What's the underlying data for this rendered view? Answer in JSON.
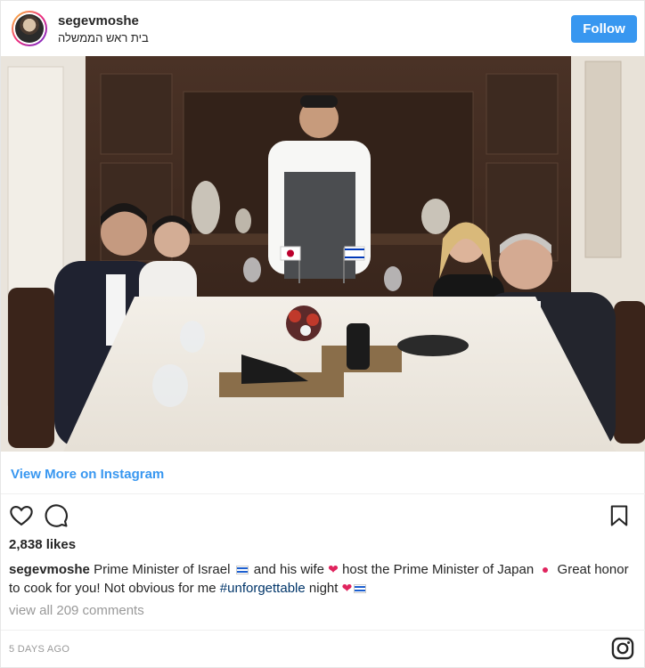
{
  "header": {
    "username": "segevmoshe",
    "location": "בית ראש הממשלה",
    "follow_label": "Follow"
  },
  "photo": {
    "flags": [
      "Japan",
      "Israel"
    ]
  },
  "view_more_label": "View More on Instagram",
  "actions": {
    "like_icon": "heart-icon",
    "comment_icon": "comment-icon",
    "save_icon": "bookmark-icon"
  },
  "likes_text": "2,838 likes",
  "caption": {
    "username": "segevmoshe",
    "part1": "Prime Minister of Israel",
    "part2": "and his wife",
    "part3": "host the Prime Minister of Japan",
    "part4": "Great honor to cook for you! Not obvious for me",
    "hashtag": "#unforgettable",
    "part5": "night"
  },
  "comments_link": "view all 209 comments",
  "timestamp": "5 DAYS AGO",
  "colors": {
    "accent": "#3897f0",
    "hashtag": "#003569",
    "heart": "#e0245e",
    "muted": "#999999"
  }
}
